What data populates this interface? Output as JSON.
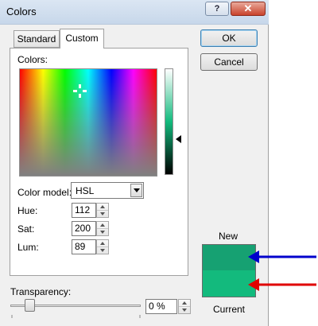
{
  "window": {
    "title": "Colors",
    "help_glyph": "?",
    "close_glyph": "✕"
  },
  "tabs": [
    {
      "label": "Standard",
      "selected": false
    },
    {
      "label": "Custom",
      "selected": true
    }
  ],
  "custom": {
    "colors_label": "Colors:",
    "color_model_label": "Color model:",
    "color_model_value": "HSL",
    "hue_label": "Hue:",
    "hue_value": "112",
    "sat_label": "Sat:",
    "sat_value": "200",
    "lum_label": "Lum:",
    "lum_value": "89"
  },
  "buttons": {
    "ok": "OK",
    "cancel": "Cancel"
  },
  "preview": {
    "new_label": "New",
    "current_label": "Current",
    "new_color": "#16a172",
    "current_color": "#13ba7d",
    "annotation_arrow_colors": [
      "#0000cc",
      "#e00000"
    ]
  },
  "transparency": {
    "label": "Transparency:",
    "value": "0 %",
    "level": 0
  },
  "icons": [
    "help-icon",
    "close-icon",
    "crosshair-icon",
    "luminance-pointer-icon",
    "dropdown-arrow-icon",
    "spin-up-icon",
    "spin-down-icon"
  ]
}
